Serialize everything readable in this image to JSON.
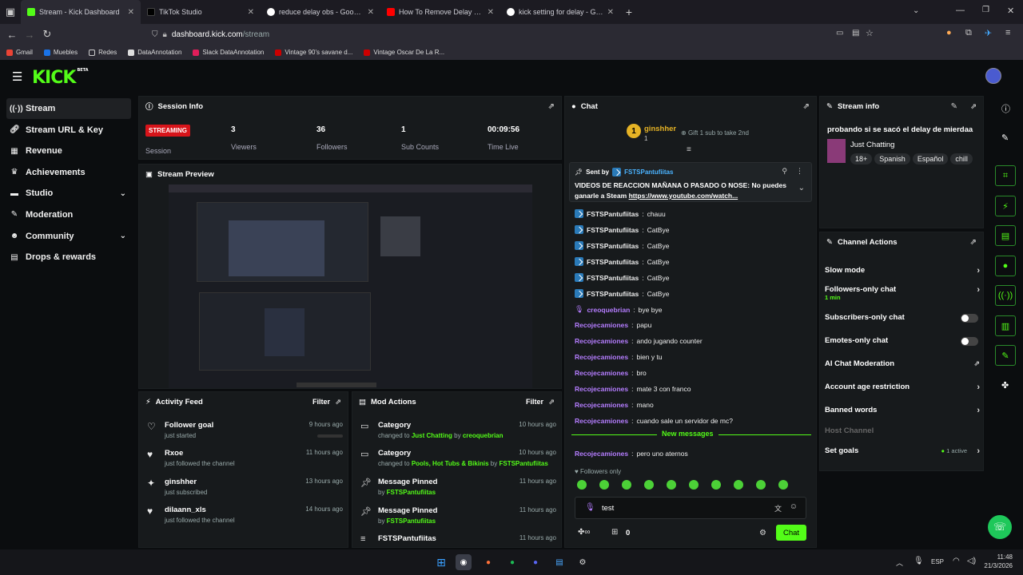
{
  "browser": {
    "tabs": [
      {
        "title": "Stream - Kick Dashboard",
        "color": "#53fc18",
        "active": true
      },
      {
        "title": "TikTok Studio",
        "color": "#111111"
      },
      {
        "title": "reduce delay obs - Google Sear",
        "color": "#4285f4"
      },
      {
        "title": "How To Remove Delay On Strea",
        "color": "#ff0000"
      },
      {
        "title": "kick setting for delay - Google S",
        "color": "#4285f4"
      }
    ],
    "url_domain": "dashboard.kick.com",
    "url_path": "/stream",
    "bookmarks": [
      "Gmail",
      "Muebles",
      "Redes",
      "DataAnnotation",
      "Slack DataAnnotation",
      "Vintage 90's savane d...",
      "Vintage Oscar De La R..."
    ]
  },
  "logo": {
    "text": "KICK",
    "beta": "BETA"
  },
  "sidebar": {
    "items": [
      {
        "label": "Stream",
        "icon": "broadcast-icon"
      },
      {
        "label": "Stream URL & Key",
        "icon": "link-icon"
      },
      {
        "label": "Revenue",
        "icon": "revenue-icon"
      },
      {
        "label": "Achievements",
        "icon": "trophy-icon"
      },
      {
        "label": "Studio",
        "icon": "studio-icon"
      },
      {
        "label": "Moderation",
        "icon": "wrench-icon"
      },
      {
        "label": "Community",
        "icon": "community-icon"
      },
      {
        "label": "Drops & rewards",
        "icon": "drops-icon"
      }
    ]
  },
  "session": {
    "title": "Session Info",
    "status": "STREAMING",
    "status_label": "Session",
    "viewers": "3",
    "viewers_label": "Viewers",
    "followers": "36",
    "followers_label": "Followers",
    "subs": "1",
    "subs_label": "Sub Counts",
    "time": "00:09:56",
    "time_label": "Time Live"
  },
  "preview": {
    "title": "Stream Preview"
  },
  "activity": {
    "title": "Activity Feed",
    "filter": "Filter",
    "items": [
      {
        "title": "Follower goal",
        "sub": "just started",
        "time": "9 hours ago"
      },
      {
        "title": "Rxoe",
        "sub": "just followed the channel",
        "time": "11 hours ago"
      },
      {
        "title": "ginshher",
        "sub": "just subscribed",
        "time": "13 hours ago"
      },
      {
        "title": "dilaann_xls",
        "sub": "just followed the channel",
        "time": "14 hours ago"
      }
    ]
  },
  "modactions": {
    "title": "Mod Actions",
    "filter": "Filter",
    "items": [
      {
        "title": "Category",
        "pre": "changed to ",
        "hl": "Just Chatting",
        "mid": " by ",
        "user": "creoquebrian",
        "time": "10 hours ago"
      },
      {
        "title": "Category",
        "pre": "changed to ",
        "hl": "Pools, Hot Tubs & Bikinis",
        "mid": " by ",
        "user": "FSTSPantufiitas",
        "time": "10 hours ago"
      },
      {
        "title": "Message Pinned",
        "pre": "by ",
        "hl": "",
        "mid": "",
        "user": "FSTSPantufiitas",
        "time": "11 hours ago"
      },
      {
        "title": "Message Pinned",
        "pre": "by ",
        "hl": "",
        "mid": "",
        "user": "FSTSPantufiitas",
        "time": "11 hours ago"
      },
      {
        "title": "FSTSPantufiitas",
        "pre": "",
        "hl": "",
        "mid": "",
        "user": "",
        "time": "11 hours ago"
      }
    ]
  },
  "chat": {
    "title": "Chat",
    "top_gifter": {
      "name": "ginshher",
      "count": "1",
      "rank": "1",
      "gift_text": "Gift 1 sub to take 2nd"
    },
    "pinned": {
      "sent_by_label": "Sent by",
      "user": "FSTSPantufiitas",
      "text": "VIDEOS DE REACCION MAÑANA O PASADO O NOSE: No puedes ganarle a Steam",
      "link": "https://www.youtube.com/watch..."
    },
    "messages": [
      {
        "user": "FSTSPantufiitas",
        "text": "chauu",
        "style": "verified"
      },
      {
        "user": "FSTSPantufiitas",
        "text": "CatBye",
        "style": "verified"
      },
      {
        "user": "FSTSPantufiitas",
        "text": "CatBye",
        "style": "verified"
      },
      {
        "user": "FSTSPantufiitas",
        "text": "CatBye",
        "style": "verified"
      },
      {
        "user": "FSTSPantufiitas",
        "text": "CatBye",
        "style": "verified"
      },
      {
        "user": "FSTSPantufiitas",
        "text": "CatBye",
        "style": "verified"
      },
      {
        "user": "creoquebrian",
        "text": "bye bye",
        "style": "mic"
      },
      {
        "user": "Recojecamiones",
        "text": "papu",
        "style": "plain"
      },
      {
        "user": "Recojecamiones",
        "text": "ando jugando counter",
        "style": "plain"
      },
      {
        "user": "Recojecamiones",
        "text": "bien y tu",
        "style": "plain"
      },
      {
        "user": "Recojecamiones",
        "text": "bro",
        "style": "plain"
      },
      {
        "user": "Recojecamiones",
        "text": "mate 3 con franco",
        "style": "plain"
      },
      {
        "user": "Recojecamiones",
        "text": "mano",
        "style": "plain"
      },
      {
        "user": "Recojecamiones",
        "text": "cuando sale un servidor de mc?",
        "style": "plain"
      }
    ],
    "new_messages": "New messages",
    "after": {
      "user": "Recojecamiones",
      "text": "pero uno aternos"
    },
    "followers_only": "Followers only",
    "input_value": "test",
    "points": "0",
    "send": "Chat"
  },
  "streaminfo": {
    "title": "Stream info",
    "stream_title": "probando si se sacó el delay de mierdaa",
    "category": "Just Chatting",
    "tags": [
      "18+",
      "Spanish",
      "Español",
      "chill"
    ]
  },
  "channelactions": {
    "title": "Channel Actions",
    "items": [
      {
        "label": "Slow mode",
        "kind": "chevron"
      },
      {
        "label": "Followers-only chat",
        "sub": "1 min",
        "kind": "chevron"
      },
      {
        "label": "Subscribers-only chat",
        "kind": "toggle"
      },
      {
        "label": "Emotes-only chat",
        "kind": "toggle"
      },
      {
        "label": "AI Chat Moderation",
        "kind": "external"
      },
      {
        "label": "Account age restriction",
        "kind": "chevron"
      },
      {
        "label": "Banned words",
        "kind": "chevron"
      },
      {
        "label": "Host Channel",
        "kind": "disabled"
      },
      {
        "label": "Set goals",
        "active": "1 active",
        "kind": "chevron"
      }
    ]
  },
  "taskbar": {
    "lang": "ESP",
    "time": "11:48",
    "date": "21/3/2026"
  }
}
